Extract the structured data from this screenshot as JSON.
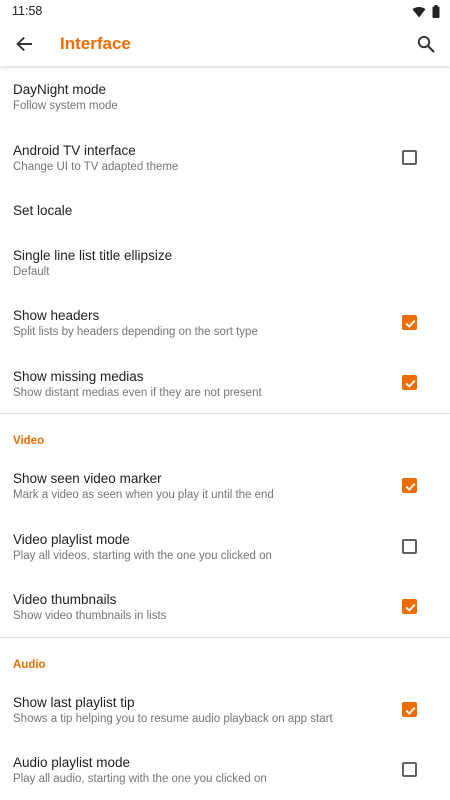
{
  "status_bar": {
    "time": "11:58",
    "icons": [
      "wifi-icon",
      "battery-icon"
    ]
  },
  "app_bar": {
    "title": "Interface",
    "back_icon": "arrow-back-icon",
    "search_icon": "search-icon"
  },
  "colors": {
    "accent": "#ef6c00",
    "title_text": "#212121",
    "summary_text": "#757575",
    "divider": "#e0e0e0"
  },
  "general": {
    "day_night": {
      "title": "DayNight mode",
      "summary": "Follow system mode"
    },
    "android_tv": {
      "title": "Android TV interface",
      "summary": "Change UI to TV adapted theme",
      "checked": false
    },
    "set_locale": {
      "title": "Set locale"
    },
    "ellipsize": {
      "title": "Single line list title ellipsize",
      "summary": "Default"
    },
    "show_headers": {
      "title": "Show headers",
      "summary": "Split lists by headers depending on the sort type",
      "checked": true
    },
    "show_missing": {
      "title": "Show missing medias",
      "summary": "Show distant medias even if they are not present",
      "checked": true
    }
  },
  "video": {
    "header": "Video",
    "seen_marker": {
      "title": "Show seen video marker",
      "summary": "Mark a video as seen when you play it until the end",
      "checked": true
    },
    "playlist_mode": {
      "title": "Video playlist mode",
      "summary": "Play all videos, starting with the one you clicked on",
      "checked": false
    },
    "thumbnails": {
      "title": "Video thumbnails",
      "summary": "Show video thumbnails in lists",
      "checked": true
    }
  },
  "audio": {
    "header": "Audio",
    "last_playlist_tip": {
      "title": "Show last playlist tip",
      "summary": "Shows a tip helping you to resume audio playback on app start",
      "checked": true
    },
    "playlist_mode": {
      "title": "Audio playlist mode",
      "summary": "Play all audio, starting with the one you clicked on",
      "checked": false
    }
  }
}
